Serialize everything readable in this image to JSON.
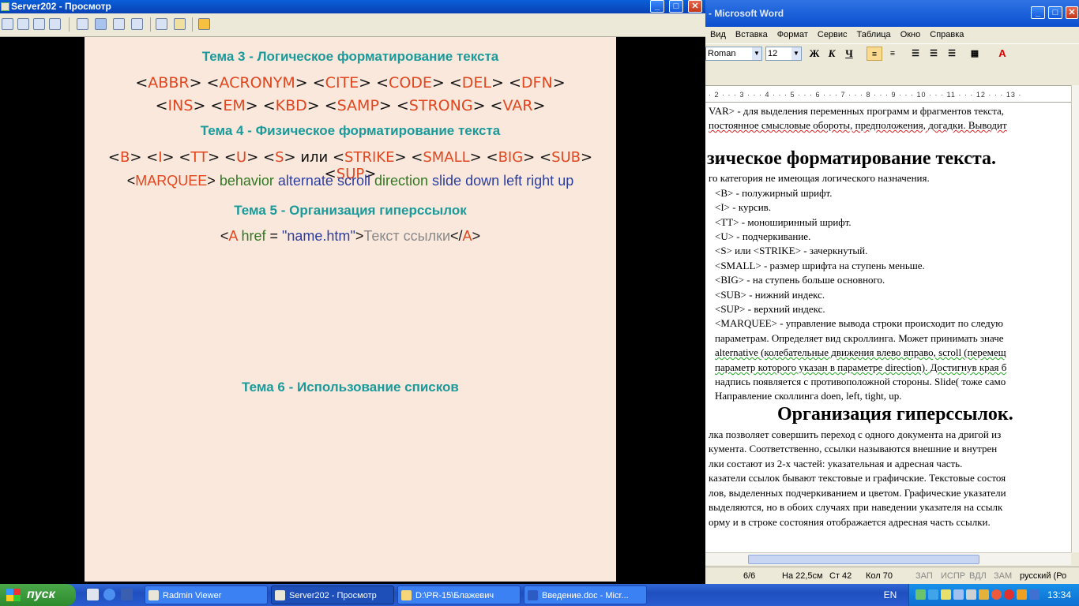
{
  "radmin": {
    "title": "Server202 - Просмотр",
    "slide": {
      "theme3_title": "Тема 3 - Логическое форматирование текста",
      "theme3_line1": [
        "<",
        "ABBR",
        "> <",
        "ACRONYM",
        "> <",
        "CITE",
        "> <",
        "CODE",
        "> <",
        "DEL",
        "> <",
        "DFN",
        ">"
      ],
      "theme3_line2": [
        "<",
        "INS",
        "> <",
        "EM",
        "> <",
        "KBD",
        "> <",
        "SAMP",
        "> <",
        "STRONG",
        "> <",
        "VAR",
        ">"
      ],
      "theme4_title": "Тема 4 - Физическое форматирование текста",
      "theme4_line1": [
        "<",
        "B",
        "> <",
        "I",
        "> <",
        "TT",
        "> <",
        "U",
        "> <",
        "S",
        "> или <",
        "STRIKE",
        "> <",
        "SMALL",
        "> <",
        "BIG",
        "> <",
        "SUB",
        "> <",
        "SUP",
        ">"
      ],
      "theme4_line2": {
        "open": "<",
        "tag": "MARQUEE",
        "close": ">",
        "behavior": "behavior",
        "alternate": "alternate",
        "scroll": "scroll",
        "direction": "direction",
        "slide": "slide",
        "down": "down",
        "left": "left",
        "right": "right",
        "up": "up"
      },
      "theme5_title": "Тема 5 - Организация гиперссылок",
      "theme5_line": {
        "p1": "<",
        "a": "A",
        "href": "href",
        "eq": " = ",
        "q1": "\"",
        "url": "name.htm",
        "q2": "\"",
        "gt": ">",
        "text": "Текст ссылки",
        "close_open": "</",
        "a2": "A",
        "close_gt": ">"
      },
      "theme6_title": "Тема 6 - Использование списков"
    }
  },
  "word": {
    "title": "- Microsoft Word",
    "menu": [
      "Вид",
      "Вставка",
      "Формат",
      "Сервис",
      "Таблица",
      "Окно",
      "Справка"
    ],
    "font": "Roman",
    "size": "12",
    "bold": "Ж",
    "italic": "К",
    "underline": "Ч",
    "ruler": "· 2 · · · 3 · · · 4 · · · 5 · · · 6 · · · 7 · · · 8 · · · 9 · · · 10 · · · 11 · · · 12 · · · 13 ·",
    "doc_lines": [
      "VAR> - для выделения переменных программ и фрагментов текста,",
      "постоянное смысловые обороты, предположения, догадки. Выводит",
      "зическое форматирование текста.",
      "го категория не имеющая логического назначения.",
      "<B> - полужирный шрифт.",
      "<I> - курсив.",
      "<TT> - моноширинный шрифт.",
      "<U> - подчеркивание.",
      "<S> или <STRIKE> - зачеркнутый.",
      "<SMALL> - размер шрифта на ступень меньше.",
      "<BIG> - на ступень больше основного.",
      "<SUB> - нижний индекс.",
      "<SUP> - верхний индекс.",
      "<MARQUEE> - управление вывода строки происходит по следую",
      "параметрам. Определяет вид скроллинга. Может принимать значе",
      "alternative (колебательные движения влево вправо, scroll (перемещ",
      "параметр которого указан в параметре direction). Достигнув края б",
      "надпись появляется с противоположной стороны. Slide( тоже само",
      "Направление сколлинга doen, left, tight, up.",
      "Организация гиперссылок.",
      "лка позволяет совершить переход с одного документа на дригой из",
      "кумента. Соответственно,  ссылки называются внешние и внутрен",
      "лки состают из 2-х частей: указательная и адресная часть.",
      "казатели ссылок бывают текстовые и графичские. Текстовые состоя",
      "лов, выделенных подчеркиванием и цветом. Графические указатели",
      "выделяются, но в обоих случаях при наведении указателя на ссылк",
      "орму и в строке состояния отображается адресная часть ссылки."
    ],
    "status": {
      "page": "6/6",
      "at": "На 22,5см",
      "line": "Ст 42",
      "col": "Кол 70",
      "rec": "ЗАП",
      "trk": "ИСПР",
      "ext": "ВДЛ",
      "ovr": "ЗАМ",
      "lang": "русский (Ро"
    }
  },
  "taskbar": {
    "start": "пуск",
    "tasks": [
      "Radmin Viewer",
      "Server202 - Просмотр",
      "D:\\PR-15\\Блажевич",
      "Введение.doc - Micr..."
    ],
    "lang": "EN",
    "clock": "13:34"
  },
  "colors": {
    "accent_title": "#1a9a9a",
    "tag_red": "#e2461e",
    "attr_green": "#2e7a22",
    "value_blue": "#2b3ea0",
    "slide_bg": "#fbe8dc"
  }
}
